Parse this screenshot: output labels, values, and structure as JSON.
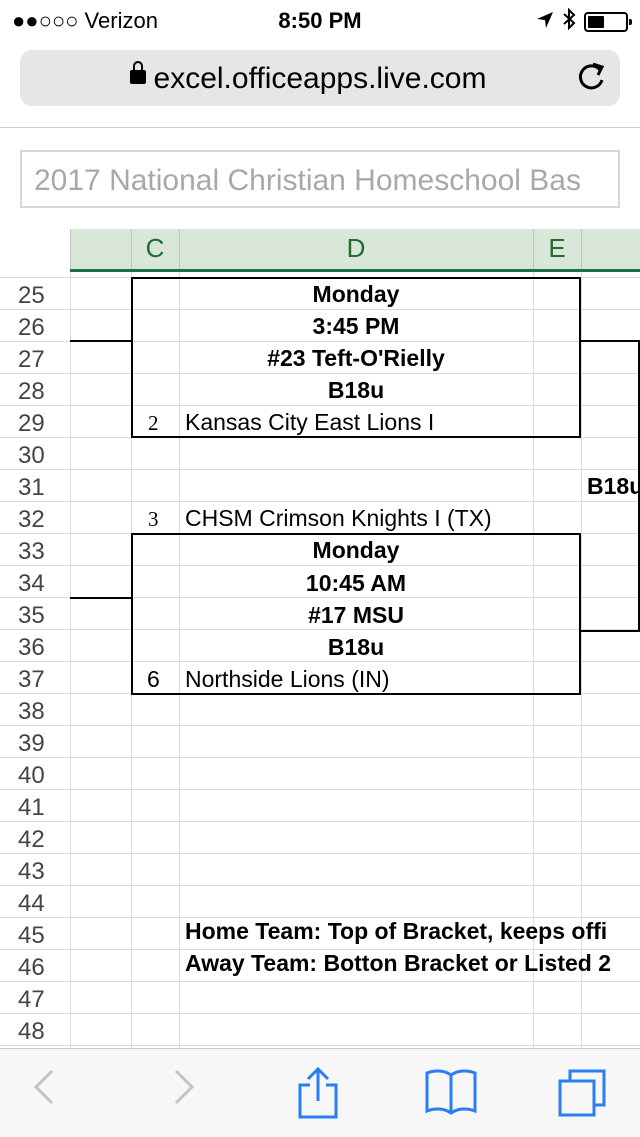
{
  "status": {
    "carrier": "●●○○○ Verizon",
    "time": "8:50 PM"
  },
  "browser": {
    "url": "excel.officeapps.live.com"
  },
  "workbook": {
    "title": "2017 National Christian Homeschool Bas"
  },
  "columns": {
    "c": "C",
    "d": "D",
    "e": "E"
  },
  "rows": [
    "25",
    "26",
    "27",
    "28",
    "29",
    "30",
    "31",
    "32",
    "33",
    "34",
    "35",
    "36",
    "37",
    "38",
    "39",
    "40",
    "41",
    "42",
    "43",
    "44",
    "45",
    "46",
    "47",
    "48"
  ],
  "game1": {
    "day": "Monday",
    "time": "3:45 PM",
    "court": "#23 Teft-O'Rielly",
    "division": "B18u",
    "seed": "2",
    "team": "Kansas City East Lions I"
  },
  "side_label": "B18u",
  "game2": {
    "top_seed": "3",
    "top_team": "CHSM Crimson Knights I (TX)",
    "day": "Monday",
    "time": "10:45 AM",
    "court": "#17 MSU",
    "division": "B18u",
    "seed": "6",
    "team": "Northside Lions (IN)"
  },
  "notes": {
    "home": "Home Team: Top of Bracket, keeps offi",
    "away": "Away Team: Botton Bracket or Listed 2"
  },
  "colors": {
    "header_green": "#1e6e2e",
    "selection_green": "#d8e7d8",
    "ios_blue": "#2a7ef0"
  }
}
